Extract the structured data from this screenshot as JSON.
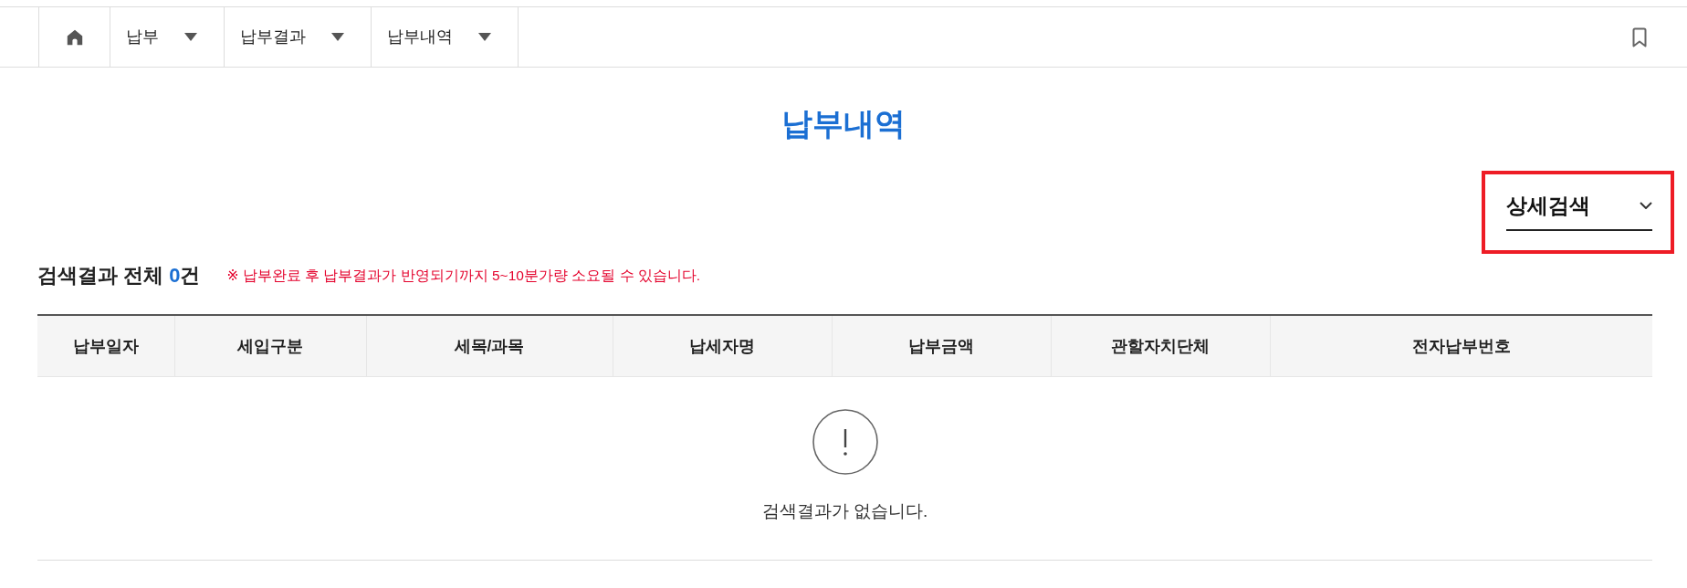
{
  "nav": {
    "items": [
      {
        "label": "납부"
      },
      {
        "label": "납부결과"
      },
      {
        "label": "납부내역"
      }
    ]
  },
  "page_title": "납부내역",
  "detail_search": {
    "label": "상세검색",
    "expanded": false,
    "highlighted": true
  },
  "result_summary": {
    "label": "검색결과 전체",
    "count": "0",
    "unit": "건",
    "note": "※ 납부완료 후 납부결과가 반영되기까지 5~10분가량 소요될 수 있습니다."
  },
  "table": {
    "columns": [
      "납부일자",
      "세입구분",
      "세목/과목",
      "납세자명",
      "납부금액",
      "관할자치단체",
      "전자납부번호"
    ],
    "empty_message": "검색결과가 없습니다."
  }
}
